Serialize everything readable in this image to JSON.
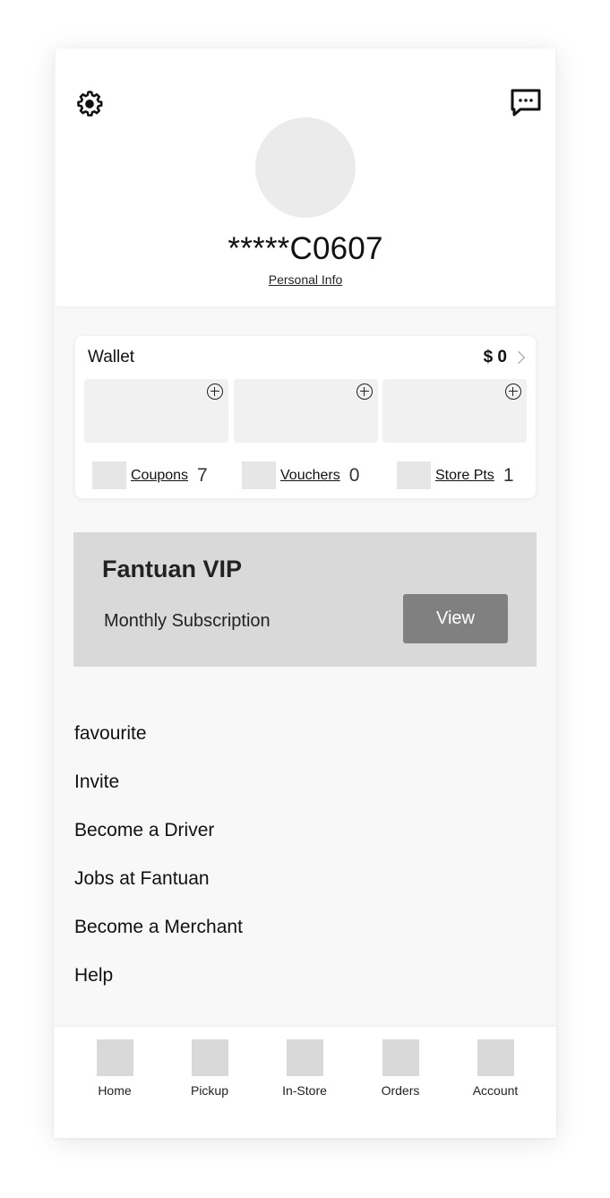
{
  "header": {
    "settings_icon": "gear-icon",
    "messages_icon": "chat-bubble-icon",
    "username": "*****C0607",
    "personal_info_label": "Personal Info"
  },
  "wallet": {
    "title": "Wallet",
    "balance": "$ 0",
    "add_icon": "plus-circle-icon",
    "stats": [
      {
        "label": "Coupons",
        "count": "7"
      },
      {
        "label": "Vouchers",
        "count": "0"
      },
      {
        "label": "Store Pts",
        "count": "1"
      }
    ]
  },
  "vip": {
    "title": "Fantuan VIP",
    "subtitle": "Monthly Subscription",
    "button_label": "View"
  },
  "menu": {
    "items": [
      "favourite",
      "Invite",
      "Become a Driver",
      "Jobs at Fantuan",
      "Become a Merchant",
      "Help"
    ]
  },
  "nav": {
    "items": [
      "Home",
      "Pickup",
      "In-Store",
      "Orders",
      "Account"
    ]
  },
  "colors": {
    "vip_background": "#d9d9d9",
    "vip_button": "#808080",
    "app_background": "#f8f8f8"
  }
}
